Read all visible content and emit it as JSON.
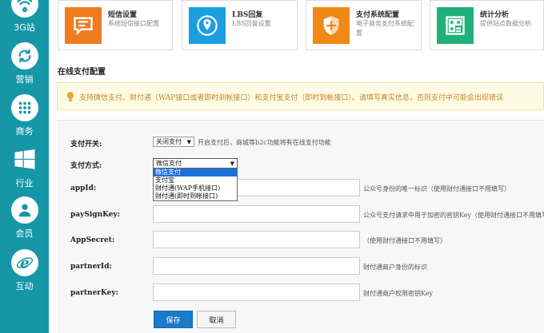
{
  "sidebar": {
    "items": [
      {
        "label": "3G站",
        "icon": "wifi-icon"
      },
      {
        "label": "营销",
        "icon": "refresh-icon"
      },
      {
        "label": "商务",
        "icon": "grid-dots-icon"
      },
      {
        "label": "行业",
        "icon": "windows-icon"
      },
      {
        "label": "会员",
        "icon": "user-icon"
      },
      {
        "label": "互动",
        "icon": "ie-icon"
      }
    ]
  },
  "cards": [
    {
      "title": "短信设置",
      "desc": "系统短信接口配置",
      "icon": "chat-icon",
      "color": "#f07c21"
    },
    {
      "title": "LBS回复",
      "desc": "LBS回复设置",
      "icon": "location-icon",
      "color": "#1c9ee0"
    },
    {
      "title": "支付系统配置",
      "desc": "电子商务支付系统配置",
      "icon": "shield-icon",
      "color": "#f08a14"
    },
    {
      "title": "统计分析",
      "desc": "提供站点数据分析",
      "icon": "dashboard-icon",
      "color": "#22b07a"
    }
  ],
  "section": {
    "title": "在线支付配置"
  },
  "notice": {
    "text": "支持微信支付、财付通（WAP接口或者即时到帐接口）和支付宝支付（即时到帐接口）。请填写真实信息，否则支付中可能会出现错误"
  },
  "form": {
    "switch": {
      "label": "支付开关:",
      "value": "关闭支付",
      "hint": "开启支付后，商城等b2c功能将有在线支付功能"
    },
    "method": {
      "label": "支付方式:",
      "value": "微信支付",
      "options": [
        "微信支付",
        "支付宝",
        "财付通(WAP手机接口)",
        "财付通(即时到帐接口)"
      ]
    },
    "fields": [
      {
        "label": "appId:",
        "value": "",
        "hint": "公众号身份的唯一标识（使用财付通接口不用填写）"
      },
      {
        "label": "paySignKey:",
        "value": "",
        "hint": "公众号支付请求中用于加密的密钥Key（使用财付通接口不用填写）"
      },
      {
        "label": "AppSecret:",
        "value": "",
        "hint": "（使用财付通接口不用填写）"
      },
      {
        "label": "partnerId:",
        "value": "",
        "hint": "财付通商户身份的标识"
      },
      {
        "label": "partnerKey:",
        "value": "",
        "hint": "财付通商户权限密钥Key"
      }
    ],
    "save_label": "保存",
    "cancel_label": "取消"
  },
  "colors": {
    "sidebar_bg": "#1796a8",
    "primary_button": "#1a7ac8",
    "notice_text": "#c7852c"
  }
}
